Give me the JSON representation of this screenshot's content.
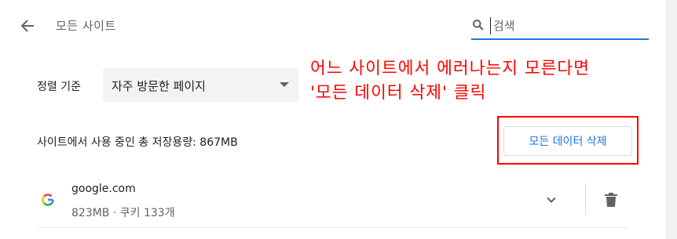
{
  "header": {
    "title": "모든 사이트",
    "search_placeholder": "검색"
  },
  "sort": {
    "label": "정렬 기준",
    "selected": "자주 방문한 페이지"
  },
  "annotation": {
    "line1": "어느 사이트에서 에러나는지 모른다면",
    "line2": "'모든 데이터 삭제' 클릭",
    "color": "#ff0000"
  },
  "storage": {
    "text": "사이트에서 사용 중인 총 저장용량: 867MB"
  },
  "clear_button": {
    "label": "모든 데이터 삭제"
  },
  "sites": [
    {
      "name": "google.com",
      "meta": "823MB · 쿠키 133개"
    }
  ],
  "colors": {
    "accent": "#1a73e8",
    "highlight": "#ff0000"
  }
}
